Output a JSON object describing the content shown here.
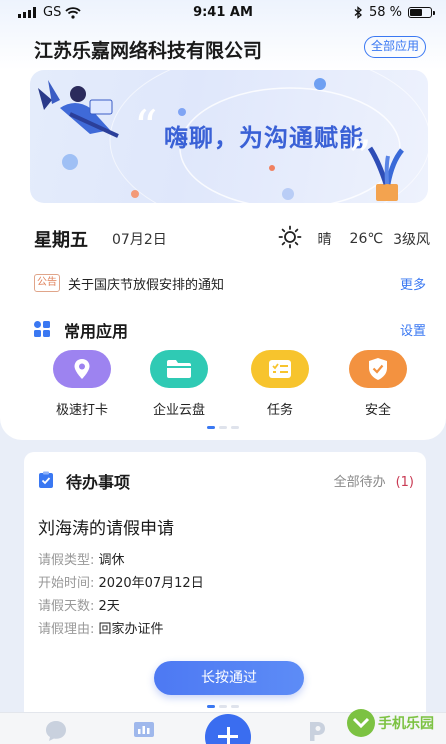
{
  "status_bar": {
    "carrier": "GS",
    "time": "9:41 AM",
    "battery": "58 %"
  },
  "header": {
    "company": "江苏乐嘉网络科技有限公司",
    "all_apps_label": "全部应用"
  },
  "banner": {
    "slogan": "嗨聊，为沟通赋能",
    "open_quote": "“",
    "close_quote": "”"
  },
  "today": {
    "weekday": "星期五",
    "date": "07月2日",
    "weather": "晴",
    "temperature": "26℃",
    "wind": "3级风",
    "weather_icon": "sun-icon"
  },
  "notice": {
    "tag": "公告",
    "text": "关于国庆节放假安排的通知",
    "more_label": "更多"
  },
  "common_apps": {
    "title": "常用应用",
    "settings_label": "设置",
    "items": [
      {
        "label": "极速打卡",
        "icon": "location-pin-icon",
        "color": "#9d83f0"
      },
      {
        "label": "企业云盘",
        "icon": "folder-icon",
        "color": "#2fcab4"
      },
      {
        "label": "任务",
        "icon": "task-list-icon",
        "color": "#f7c42d"
      },
      {
        "label": "安全",
        "icon": "shield-check-icon",
        "color": "#f39240"
      }
    ],
    "page_indicator": {
      "pages": 3,
      "current": 1
    }
  },
  "todo": {
    "title": "待办事项",
    "all_label": "全部待办",
    "count": "(1)",
    "item": {
      "title": "刘海涛的请假申请",
      "fields": [
        {
          "key": "请假类型:",
          "value": "调休"
        },
        {
          "key": "开始时间:",
          "value": "2020年07月12日"
        },
        {
          "key": "请假天数:",
          "value": "2天"
        },
        {
          "key": "请假理由:",
          "value": "回家办证件"
        }
      ]
    },
    "approve_label": "长按通过"
  },
  "tabbar": {
    "tabs": [
      "chat-icon",
      "dashboard-icon",
      "plus-icon",
      "apps-icon"
    ]
  },
  "watermark": {
    "text": "手机乐园"
  }
}
